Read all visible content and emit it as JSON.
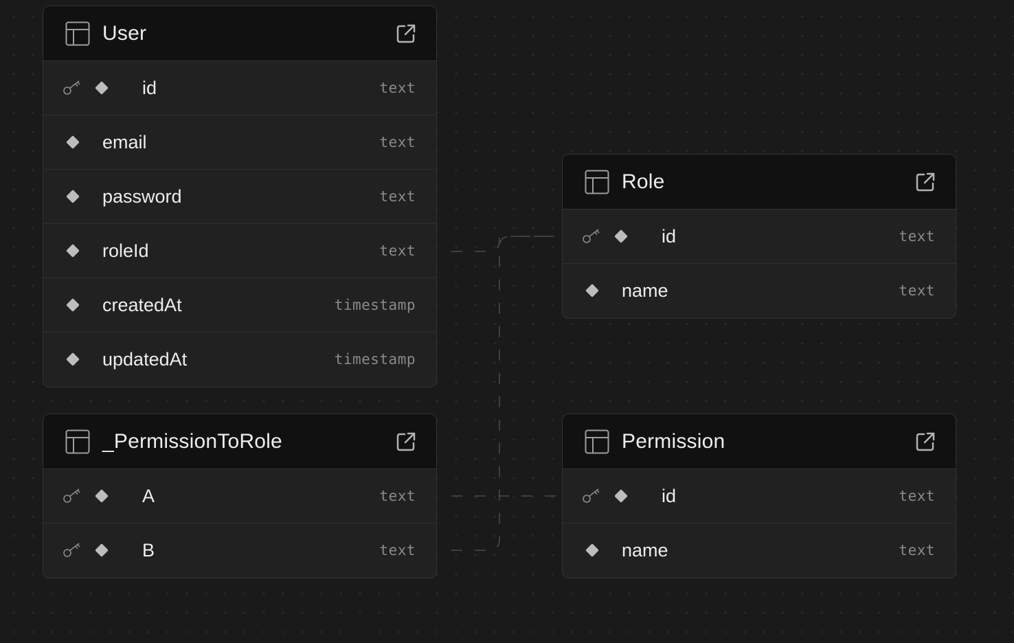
{
  "tables": [
    {
      "id": "user",
      "name": "User",
      "columns": [
        {
          "name": "id",
          "type": "text",
          "primary_key": true
        },
        {
          "name": "email",
          "type": "text",
          "primary_key": false
        },
        {
          "name": "password",
          "type": "text",
          "primary_key": false
        },
        {
          "name": "roleId",
          "type": "text",
          "primary_key": false
        },
        {
          "name": "createdAt",
          "type": "timestamp",
          "primary_key": false
        },
        {
          "name": "updatedAt",
          "type": "timestamp",
          "primary_key": false
        }
      ]
    },
    {
      "id": "permission-to-role",
      "name": "_PermissionToRole",
      "columns": [
        {
          "name": "A",
          "type": "text",
          "primary_key": true
        },
        {
          "name": "B",
          "type": "text",
          "primary_key": true
        }
      ]
    },
    {
      "id": "role",
      "name": "Role",
      "columns": [
        {
          "name": "id",
          "type": "text",
          "primary_key": true
        },
        {
          "name": "name",
          "type": "text",
          "primary_key": false
        }
      ]
    },
    {
      "id": "permission",
      "name": "Permission",
      "columns": [
        {
          "name": "id",
          "type": "text",
          "primary_key": true
        },
        {
          "name": "name",
          "type": "text",
          "primary_key": false
        }
      ]
    }
  ],
  "relationships": [
    {
      "from": "User.roleId",
      "to": "Role.id"
    },
    {
      "from": "_PermissionToRole.A",
      "to": "Permission.id"
    },
    {
      "from": "_PermissionToRole.B",
      "to": "Role.id"
    }
  ],
  "colors": {
    "background": "#1a1a1a",
    "card": "#212121",
    "header": "#111111",
    "border": "#333333",
    "text": "#ededed",
    "type_text": "#8a8a8a",
    "diamond": "#bdbdbd",
    "connector": "#4a4a4a"
  },
  "icons": {
    "table": "table-icon",
    "open": "external-link-icon",
    "primary_key": "key-icon",
    "column": "diamond-icon"
  }
}
